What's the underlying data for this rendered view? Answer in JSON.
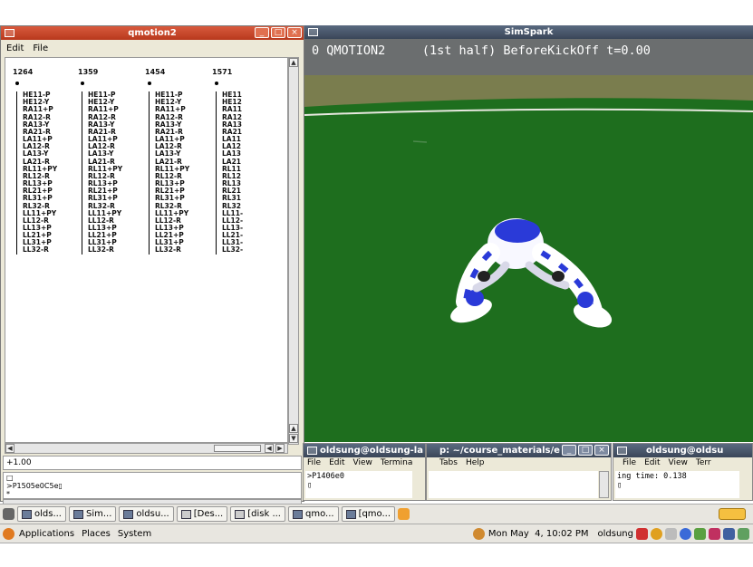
{
  "qmotion": {
    "title": "qmotion2",
    "menu": [
      "Edit",
      "File"
    ],
    "columns": [
      {
        "frame": "1264",
        "joints": [
          "HE11-P",
          "HE12-Y",
          "RA11+P",
          "RA12-R",
          "RA13-Y",
          "RA21-R",
          "LA11+P",
          "LA12-R",
          "LA13-Y",
          "LA21-R",
          "RL11+PY",
          "RL12-R",
          "RL13+P",
          "RL21+P",
          "RL31+P",
          "RL32-R",
          "LL11+PY",
          "LL12-R",
          "LL13+P",
          "LL21+P",
          "LL31+P",
          "LL32-R"
        ]
      },
      {
        "frame": "1359",
        "joints": [
          "HE11-P",
          "HE12-Y",
          "RA11+P",
          "RA12-R",
          "RA13-Y",
          "RA21-R",
          "LA11+P",
          "LA12-R",
          "LA13-Y",
          "LA21-R",
          "RL11+PY",
          "RL12-R",
          "RL13+P",
          "RL21+P",
          "RL31+P",
          "RL32-R",
          "LL11+PY",
          "LL12-R",
          "LL13+P",
          "LL21+P",
          "LL31+P",
          "LL32-R"
        ]
      },
      {
        "frame": "1454",
        "joints": [
          "HE11-P",
          "HE12-Y",
          "RA11+P",
          "RA12-R",
          "RA13-Y",
          "RA21-R",
          "LA11+P",
          "LA12-R",
          "LA13-Y",
          "LA21-R",
          "RL11+PY",
          "RL12-R",
          "RL13+P",
          "RL21+P",
          "RL31+P",
          "RL32-R",
          "LL11+PY",
          "LL12-R",
          "LL13+P",
          "LL21+P",
          "LL31+P",
          "LL32-R"
        ]
      },
      {
        "frame": "1571",
        "joints": [
          "HE11",
          "HE12",
          "RA11",
          "RA12",
          "RA13",
          "RA21",
          "LA11",
          "LA12",
          "LA13",
          "LA21",
          "RL11",
          "RL12",
          "RL13",
          "RL21",
          "RL31",
          "RL32",
          "LL11-",
          "LL12-",
          "LL13-",
          "LL21-",
          "LL31-",
          "LL32-"
        ]
      }
    ],
    "command_value": "+1.00",
    "output_lines": [
      "□",
      ">P1505e0C5e▯",
      "*"
    ]
  },
  "simspark": {
    "title": "SimSpark",
    "hud": "0 QMOTION2     (1st half) BeforeKickOff t=0.00"
  },
  "terminals": [
    {
      "title": "oldsung@oldsung-la",
      "menu": [
        "File",
        "Edit",
        "View",
        "Termina"
      ],
      "lines": [
        ">P1406e0",
        "▯"
      ]
    },
    {
      "title": "p: ~/course_materials/e",
      "menu": [
        "Tabs",
        "Help"
      ],
      "lines": [
        "",
        ""
      ]
    },
    {
      "title": "oldsung@oldsu",
      "menu": [
        "File",
        "Edit",
        "View",
        "Terr"
      ],
      "lines": [
        "ing time: 0.138",
        "▯"
      ]
    }
  ],
  "taskbar": {
    "items": [
      "olds...",
      "Sim...",
      "oldsu...",
      "[Des...",
      "[disk ...",
      "qmo...",
      "[qmo..."
    ]
  },
  "top_panel": {
    "menus": [
      "Applications",
      "Places",
      "System"
    ],
    "clock": "Mon May  4, 10:02 PM",
    "user": "oldsung"
  },
  "colors": {
    "field": "#1e6e1e",
    "wall": "#7a7d4e",
    "active_title": "#c8472a",
    "inactive_title": "#4b5a6e"
  }
}
